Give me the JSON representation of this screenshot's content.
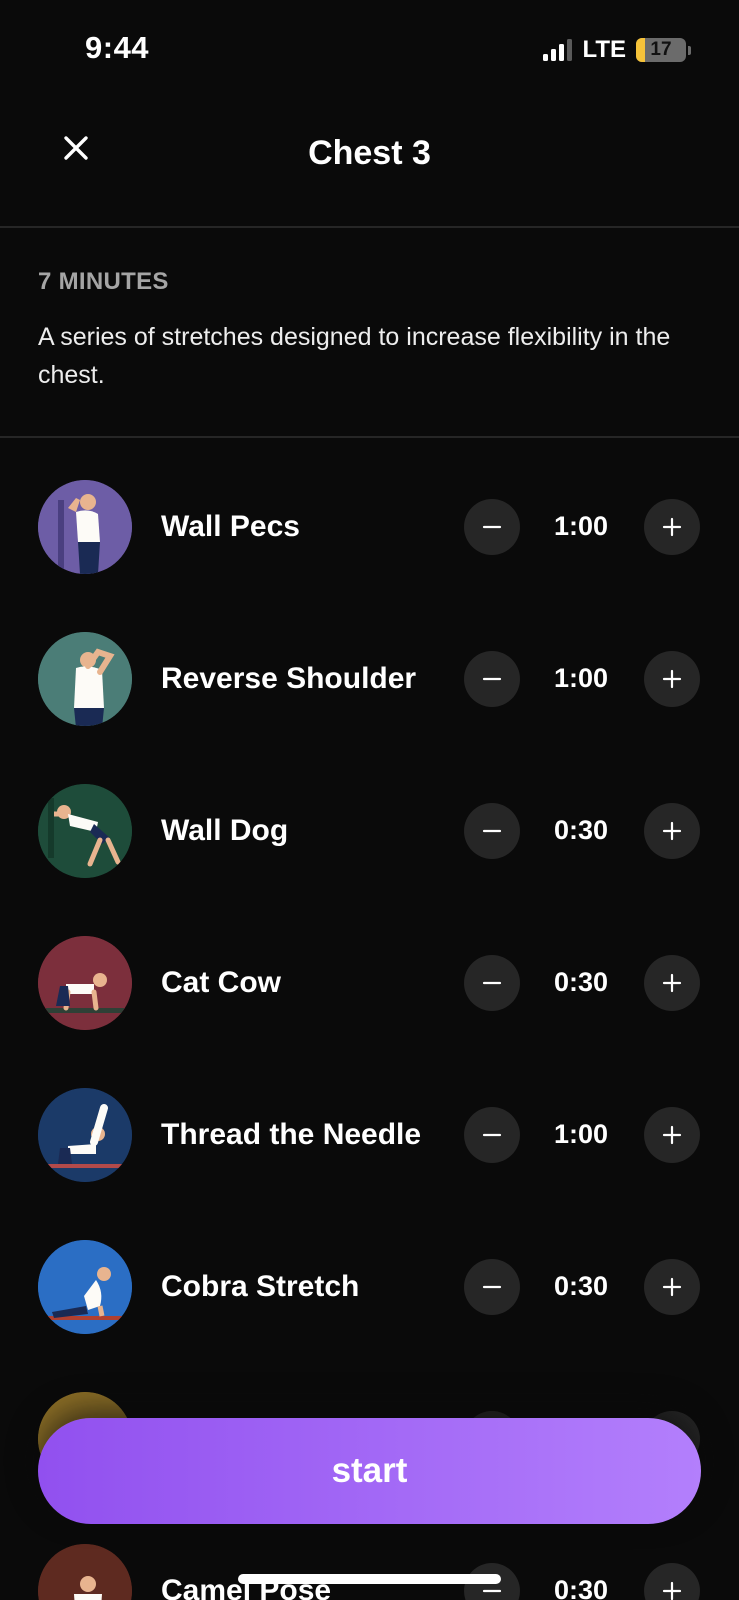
{
  "status_bar": {
    "time": "9:44",
    "network": "LTE",
    "battery": "17",
    "battery_color": "#f6c33a"
  },
  "header": {
    "title": "Chest 3",
    "close_icon": "close-icon"
  },
  "intro": {
    "duration": "7 MINUTES",
    "description": "A series of stretches designed to increase flexibility in the chest."
  },
  "exercises": [
    {
      "name": "Wall Pecs",
      "time": "1:00",
      "color": "#6d5da6"
    },
    {
      "name": "Reverse Shoulder",
      "time": "1:00",
      "color": "#4b7d77"
    },
    {
      "name": "Wall Dog",
      "time": "0:30",
      "color": "#1e4c3a"
    },
    {
      "name": "Cat Cow",
      "time": "0:30",
      "color": "#7c2f3c"
    },
    {
      "name": "Thread the Needle",
      "time": "1:00",
      "color": "#1b3a68"
    },
    {
      "name": "Cobra Stretch",
      "time": "0:30",
      "color": "#2b6ec4"
    },
    {
      "name": "",
      "time": "",
      "color": "#8a6d26"
    },
    {
      "name": "Camel Pose",
      "time": "0:30",
      "color": "#5e2a20"
    }
  ],
  "controls": {
    "minus_icon": "minus-icon",
    "plus_icon": "plus-icon"
  },
  "start": {
    "label": "start",
    "accent_start": "#9150ef",
    "accent_end": "#b37ffc"
  }
}
